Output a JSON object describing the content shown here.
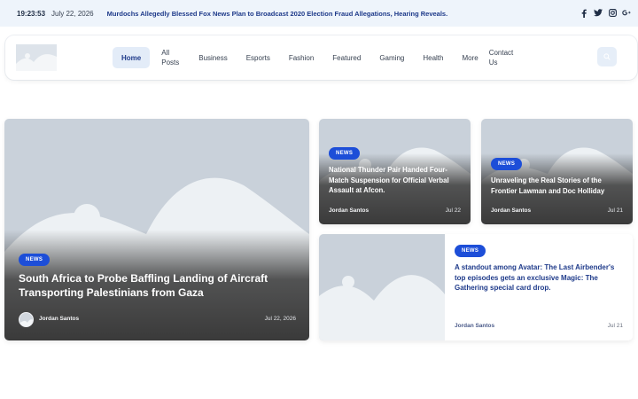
{
  "topbar": {
    "time": "19:23:53",
    "date": "July 22, 2026",
    "ticker": "Murdochs Allegedly Blessed Fox News Plan to Broadcast 2020 Election Fraud Allegations, Hearing Reveals."
  },
  "nav": {
    "items": [
      {
        "label": "Home"
      },
      {
        "label": "All\nPosts"
      },
      {
        "label": "Business"
      },
      {
        "label": "Esports"
      },
      {
        "label": "Fashion"
      },
      {
        "label": "Featured"
      },
      {
        "label": "Gaming"
      },
      {
        "label": "Health"
      },
      {
        "label": "More"
      },
      {
        "label": "Contact\nUs"
      }
    ]
  },
  "hero": {
    "badge": "NEWS",
    "title": "South Africa to Probe Baffling Landing of Aircraft Transporting Palestinians from Gaza",
    "author": "Jordan Santos",
    "date": "Jul 22, 2026"
  },
  "card2": {
    "badge": "NEWS",
    "title": "National Thunder Pair Handed Four-Match Suspension for Official Verbal Assault at Afcon.",
    "author": "Jordan Santos",
    "date": "Jul 22"
  },
  "card3": {
    "badge": "NEWS",
    "title": "Unraveling the Real Stories of the Frontier Lawman and Doc Holliday",
    "author": "Jordan Santos",
    "date": "Jul 21"
  },
  "card4": {
    "badge": "NEWS",
    "title": "A standout among Avatar: The Last Airbender's top episodes gets an exclusive Magic: The Gathering special card drop.",
    "author": "Jordan Santos",
    "date": "Jul 21"
  },
  "colors": {
    "accent": "#1d4ed8",
    "nav_active_bg": "#e3ecf8",
    "topbar_bg": "#eef4fb",
    "placeholder": "#c9d1da"
  },
  "icons": [
    "facebook-icon",
    "twitter-icon",
    "instagram-icon",
    "google-plus-icon",
    "search-icon",
    "image-placeholder-icon"
  ]
}
